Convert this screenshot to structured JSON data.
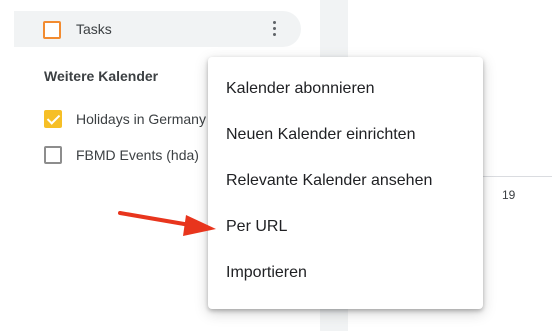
{
  "sidebar": {
    "tasks": {
      "label": "Tasks",
      "checkbox_color": "#f28b30"
    },
    "section_title": "Weitere Kalender",
    "calendars": [
      {
        "label": "Holidays in Germany",
        "checked": true,
        "color": "#f6bf26"
      },
      {
        "label": "FBMD Events (hda)",
        "checked": false
      }
    ]
  },
  "calendar_grid": {
    "day_number": "19"
  },
  "context_menu": {
    "items": [
      "Kalender abonnieren",
      "Neuen Kalender einrichten",
      "Relevante Kalender ansehen",
      "Per URL",
      "Importieren"
    ]
  },
  "annotation": {
    "arrow_color": "#e8351d",
    "points_to": "Per URL"
  }
}
